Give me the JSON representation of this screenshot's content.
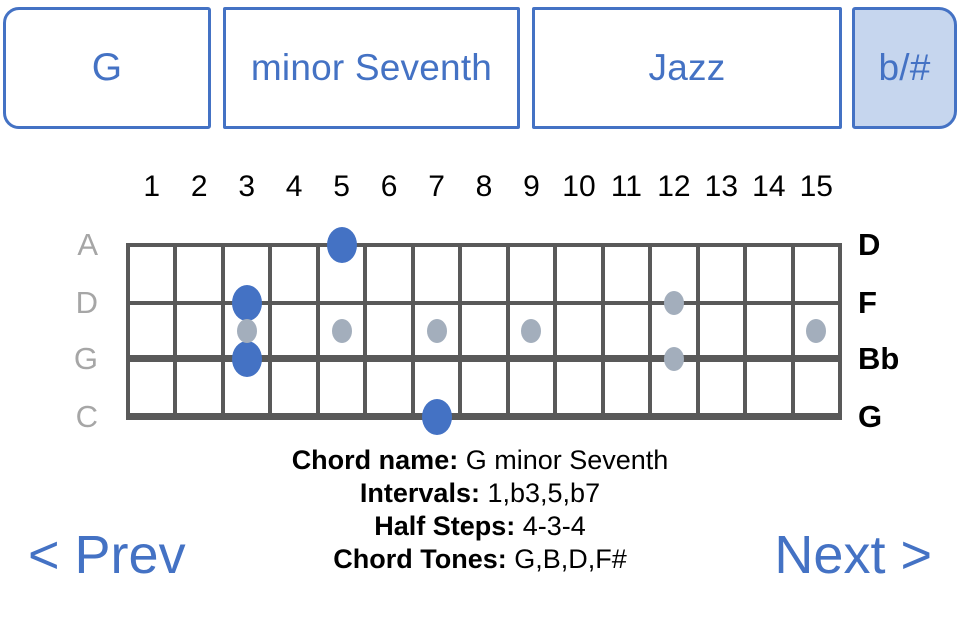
{
  "selector": {
    "root": "G",
    "quality": "minor Seventh",
    "style": "Jazz",
    "accidental": "b/#"
  },
  "colors": {
    "accent": "#4472C4",
    "accent_fill": "#C6D6EE",
    "grid": "#595959",
    "inlay": "#A3AEBC",
    "left_label": "#A6A6A6"
  },
  "fretboard": {
    "fret_numbers": [
      "1",
      "2",
      "3",
      "4",
      "5",
      "6",
      "7",
      "8",
      "9",
      "10",
      "11",
      "12",
      "13",
      "14",
      "15"
    ],
    "open_string_labels": [
      "A",
      "D",
      "G",
      "C"
    ],
    "fretted_note_labels": [
      "D",
      "F",
      "Bb",
      "G"
    ],
    "chord_dots": [
      {
        "string": 0,
        "fret": 5
      },
      {
        "string": 1,
        "fret": 3
      },
      {
        "string": 2,
        "fret": 3
      },
      {
        "string": 3,
        "fret": 7
      }
    ],
    "inlay_dots": [
      {
        "fret": 3,
        "position": "middle"
      },
      {
        "fret": 5,
        "position": "middle"
      },
      {
        "fret": 7,
        "position": "middle"
      },
      {
        "fret": 9,
        "position": "middle"
      },
      {
        "fret": 12,
        "position": "upper"
      },
      {
        "fret": 12,
        "position": "lower"
      },
      {
        "fret": 15,
        "position": "middle"
      }
    ]
  },
  "info": {
    "chord_name_label": "Chord name:",
    "chord_name_value": "G minor Seventh",
    "intervals_label": "Intervals:",
    "intervals_value": "1,b3,5,b7",
    "half_steps_label": "Half Steps:",
    "half_steps_value": "4-3-4",
    "chord_tones_label": "Chord Tones:",
    "chord_tones_value": "G,B,D,F#"
  },
  "nav": {
    "prev": "< Prev",
    "next": "Next >"
  }
}
